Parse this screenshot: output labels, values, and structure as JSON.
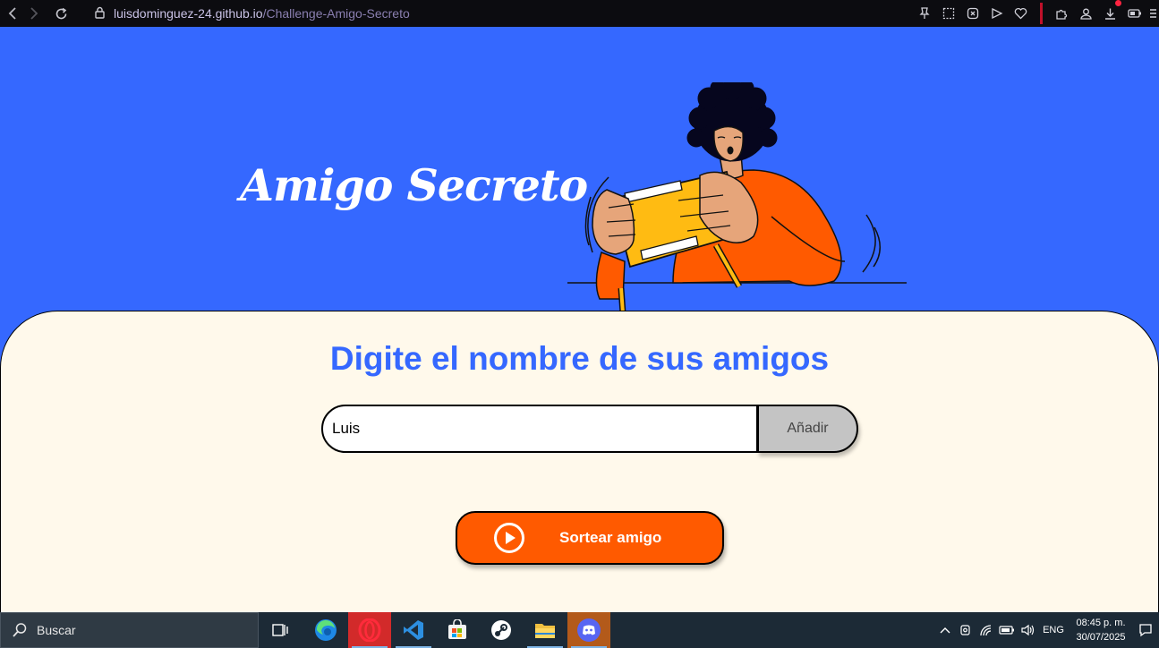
{
  "browser": {
    "url_host": "luisdominguez-24.github.io",
    "url_path": "/Challenge-Amigo-Secreto"
  },
  "hero": {
    "title": "Amigo Secreto"
  },
  "main": {
    "heading": "Digite el nombre de sus amigos",
    "name_input_value": "Luis",
    "add_button_label": "Añadir",
    "draw_button_label": "Sortear amigo"
  },
  "taskbar": {
    "search_label": "Buscar",
    "language": "ENG",
    "time": "08:45 p. m.",
    "date": "30/07/2025"
  },
  "colors": {
    "brand_blue": "#3568ff",
    "panel_cream": "#fff9eb",
    "accent_orange": "#ff5a00",
    "button_gray": "#c4c4c4"
  }
}
